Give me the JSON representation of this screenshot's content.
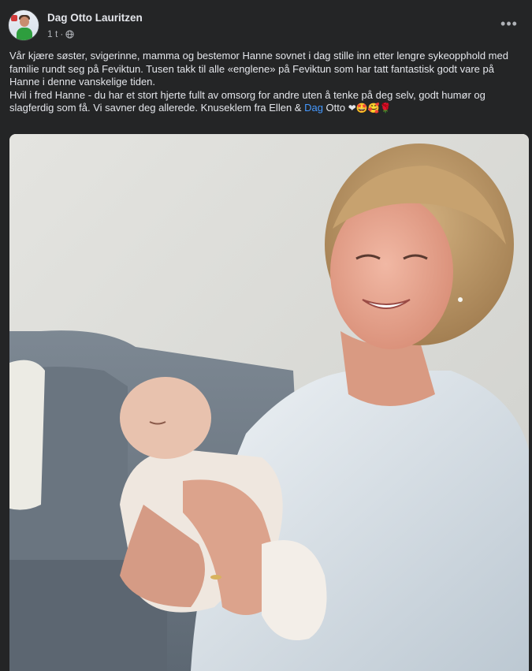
{
  "post": {
    "author": "Dag Otto Lauritzen",
    "time": "1 t",
    "separator": "·",
    "privacy_icon": "globe-icon",
    "more_icon": "more-options-icon",
    "more_label": "•••",
    "paragraph1": "Vår kjære søster, svigerinne, mamma og bestemor Hanne sovnet i dag stille inn etter lengre sykeopphold med familie rundt seg på Feviktun.  Tusen takk til alle «englene» på Feviktun som har tatt fantastisk godt vare på Hanne i denne vanskelige tiden.",
    "paragraph2_a": "Hvil i fred Hanne - du har et stort hjerte fullt av omsorg for andre uten å tenke på deg selv, godt humør og slagferdig som få. Vi savner deg allerede.  Knuseklem fra Ellen & ",
    "paragraph2_mention": "Dag",
    "paragraph2_b": " Otto ",
    "emojis": "❤🤩🥰🌹",
    "photo_icon": "photo-grandmother-with-newborn"
  },
  "colors": {
    "background": "#242526",
    "text": "#e4e6eb",
    "secondary_text": "#b0b3b8",
    "mention": "#4599ff"
  }
}
